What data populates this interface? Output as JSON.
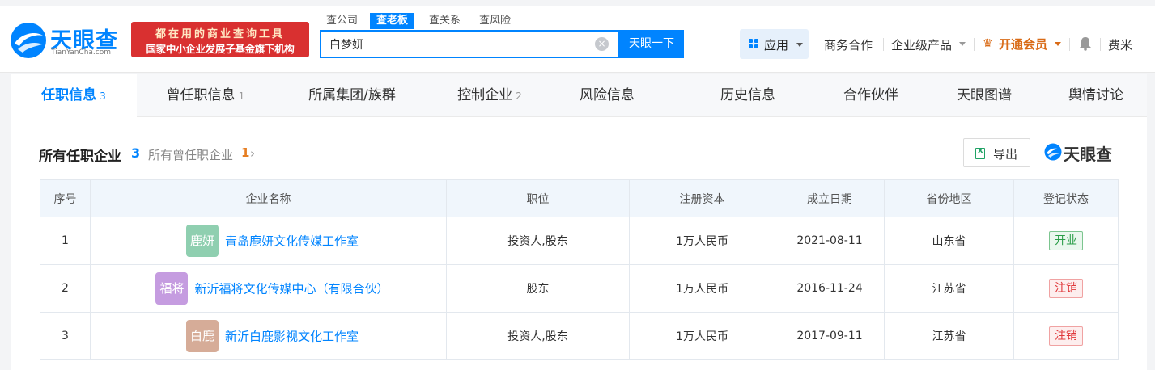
{
  "brand": {
    "name": "天眼查",
    "domain": "TianYanCha.com",
    "color": "#0084ff"
  },
  "banner": {
    "line1": "都在用的商业查询工具",
    "line2": "国家中小企业发展子基金旗下机构"
  },
  "search_tabs": [
    {
      "label": "查公司",
      "active": false
    },
    {
      "label": "查老板",
      "active": true
    },
    {
      "label": "查关系",
      "active": false
    },
    {
      "label": "查风险",
      "active": false
    }
  ],
  "search": {
    "value": "白梦妍",
    "button": "天眼一下"
  },
  "nav": {
    "apps": "应用",
    "business": "商务合作",
    "enterprise": "企业级产品",
    "vip": "开通会员",
    "user": "费米"
  },
  "tabs": [
    {
      "label": "任职信息",
      "count": "3",
      "active": true
    },
    {
      "label": "曾任职信息",
      "count": "1",
      "active": false
    },
    {
      "label": "所属集团/族群",
      "count": "",
      "active": false
    },
    {
      "label": "控制企业",
      "count": "2",
      "active": false
    },
    {
      "label": "风险信息",
      "count": "",
      "active": false
    },
    {
      "label": "历史信息",
      "count": "",
      "active": false
    },
    {
      "label": "合作伙伴",
      "count": "",
      "active": false
    },
    {
      "label": "天眼图谱",
      "count": "",
      "active": false
    },
    {
      "label": "舆情讨论",
      "count": "",
      "active": false
    }
  ],
  "section": {
    "title": "所有任职企业",
    "count": "3",
    "sub_label": "所有曾任职企业",
    "sub_count": "1",
    "export": "导出",
    "watermark": "天眼查"
  },
  "table": {
    "headers": [
      "序号",
      "企业名称",
      "职位",
      "注册资本",
      "成立日期",
      "省份地区",
      "登记状态"
    ],
    "rows": [
      {
        "no": "1",
        "avatar": "鹿妍",
        "avatar_color": "#8fcfb0",
        "name": "青岛鹿妍文化传媒工作室",
        "position": "投资人,股东",
        "capital": "1万人民币",
        "date": "2021-08-11",
        "region": "山东省",
        "status": "开业",
        "status_type": "open"
      },
      {
        "no": "2",
        "avatar": "福将",
        "avatar_color": "#c59ce0",
        "name": "新沂福将文化传媒中心（有限合伙）",
        "position": "股东",
        "capital": "1万人民币",
        "date": "2016-11-24",
        "region": "江苏省",
        "status": "注销",
        "status_type": "closed"
      },
      {
        "no": "3",
        "avatar": "白鹿",
        "avatar_color": "#d6ac98",
        "name": "新沂白鹿影视文化工作室",
        "position": "投资人,股东",
        "capital": "1万人民币",
        "date": "2017-09-11",
        "region": "江苏省",
        "status": "注销",
        "status_type": "closed"
      }
    ]
  }
}
